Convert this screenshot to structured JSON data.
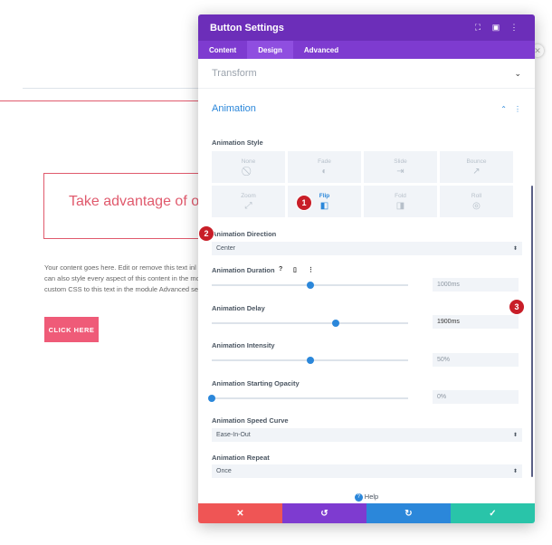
{
  "background": {
    "headline": "Take advantage of ou",
    "paragraph": [
      "Your content goes here. Edit or remove this text inl",
      "can also style every aspect of this content in the mo",
      "custom CSS to this text in the module Advanced se"
    ],
    "button_label": "CLICK HERE",
    "close_glyph": "✕"
  },
  "modal": {
    "title": "Button Settings",
    "header_icons": [
      "expand-icon",
      "sidebar-icon",
      "more-icon"
    ],
    "tabs": [
      {
        "label": "Content",
        "active": false
      },
      {
        "label": "Design",
        "active": true
      },
      {
        "label": "Advanced",
        "active": false
      }
    ],
    "transform_label": "Transform",
    "animation_label": "Animation",
    "animation_style_label": "Animation Style",
    "styles": [
      {
        "label": "None",
        "icon": "⃠"
      },
      {
        "label": "Fade",
        "icon": "◐"
      },
      {
        "label": "Slide",
        "icon": "⇥"
      },
      {
        "label": "Bounce",
        "icon": "↗"
      },
      {
        "label": "Zoom",
        "icon": "⤢"
      },
      {
        "label": "Flip",
        "icon": "◧"
      },
      {
        "label": "Fold",
        "icon": "◨"
      },
      {
        "label": "Roll",
        "icon": "◎"
      }
    ],
    "selected_style": "Flip",
    "direction_label": "Animation Direction",
    "direction_value": "Center",
    "duration_label": "Animation Duration",
    "duration_value": "1000ms",
    "duration_level": 0.5,
    "delay_label": "Animation Delay",
    "delay_value": "1900ms",
    "delay_level": 0.63,
    "intensity_label": "Animation Intensity",
    "intensity_value": "50%",
    "intensity_level": 0.5,
    "opacity_label": "Animation Starting Opacity",
    "opacity_value": "0%",
    "opacity_level": 0,
    "curve_label": "Animation Speed Curve",
    "curve_value": "Ease-In-Out",
    "repeat_label": "Animation Repeat",
    "repeat_value": "Once",
    "help_label": "Help",
    "footer": {
      "cancel": "✕",
      "undo": "↺",
      "redo": "↻",
      "save": "✓"
    },
    "colors": {
      "header": "#6c2eb9",
      "accent": "#2b87da",
      "cancel": "#ef5555",
      "undo": "#7e3bd0",
      "redo": "#2b87da",
      "save": "#29c4a9"
    }
  },
  "callouts": [
    "1",
    "2",
    "3"
  ]
}
